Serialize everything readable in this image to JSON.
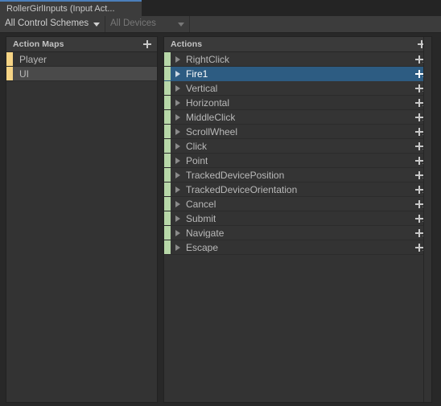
{
  "window": {
    "tab_label": "RollerGirlInputs (Input Act...",
    "accent_color": "#4b7fbb",
    "background": "#282828"
  },
  "toolbar": {
    "control_schemes": {
      "label": "All Control Schemes",
      "icon": "chevron-down-icon",
      "enabled": true
    },
    "devices": {
      "label": "All Devices",
      "icon": "chevron-down-icon",
      "enabled": false
    }
  },
  "action_maps_panel": {
    "title": "Action Maps",
    "add_icon": "plus-icon",
    "accent_color": "#f6d485",
    "items": [
      {
        "label": "Player",
        "selected": false
      },
      {
        "label": "UI",
        "selected": true
      }
    ]
  },
  "actions_panel": {
    "title": "Actions",
    "add_icon": "plus-icon",
    "accent_color": "#b7d7a8",
    "selection_color": "#2d5c82",
    "row_add_icon": "plus-with-dropdown-icon",
    "foldout_icon": "triangle-right-icon",
    "items": [
      {
        "label": "RightClick",
        "selected": false
      },
      {
        "label": "Fire1",
        "selected": true
      },
      {
        "label": "Vertical",
        "selected": false
      },
      {
        "label": "Horizontal",
        "selected": false
      },
      {
        "label": "MiddleClick",
        "selected": false
      },
      {
        "label": "ScrollWheel",
        "selected": false
      },
      {
        "label": "Click",
        "selected": false
      },
      {
        "label": "Point",
        "selected": false
      },
      {
        "label": "TrackedDevicePosition",
        "selected": false
      },
      {
        "label": "TrackedDeviceOrientation",
        "selected": false
      },
      {
        "label": "Cancel",
        "selected": false
      },
      {
        "label": "Submit",
        "selected": false
      },
      {
        "label": "Navigate",
        "selected": false
      },
      {
        "label": "Escape",
        "selected": false
      }
    ]
  }
}
